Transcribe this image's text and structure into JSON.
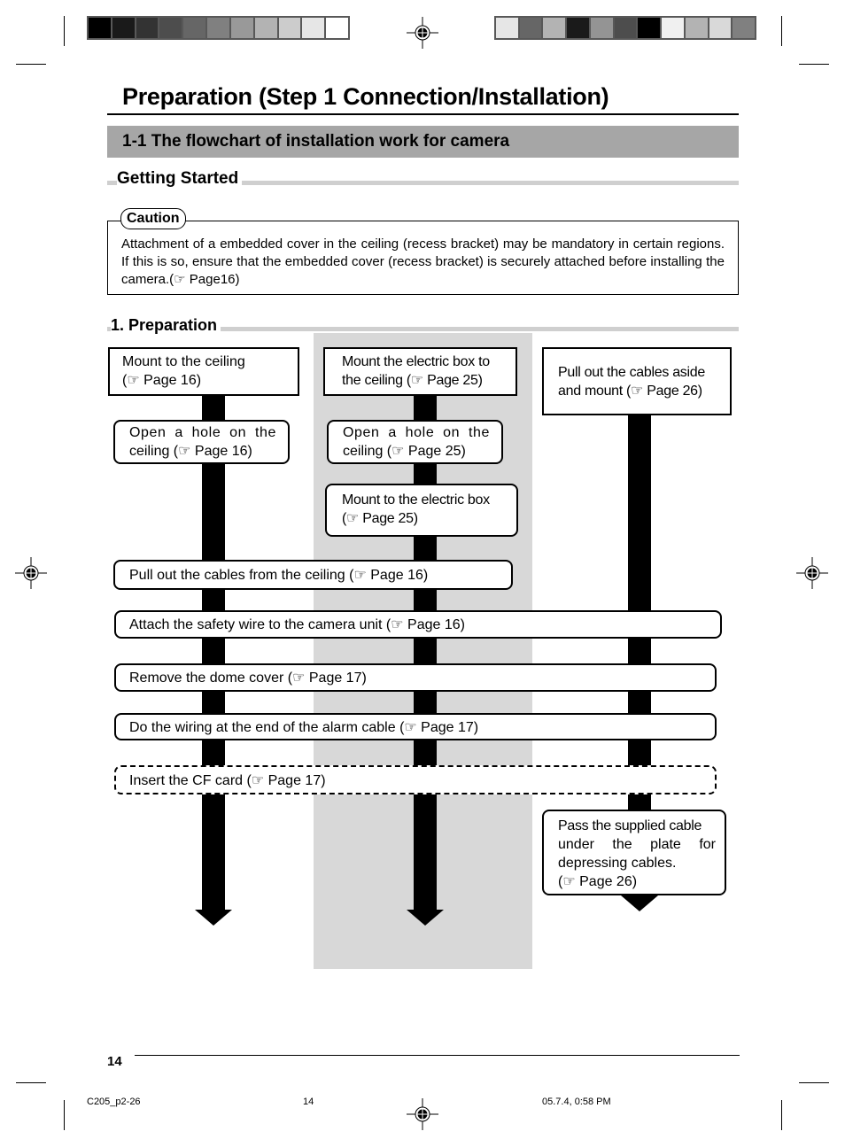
{
  "color_bars": {
    "left": [
      "#000000",
      "#1a1a1a",
      "#333333",
      "#4d4d4d",
      "#666666",
      "#808080",
      "#999999",
      "#b3b3b3",
      "#cccccc",
      "#e6e6e6",
      "#ffffff"
    ],
    "right": [
      "#e6e6e6",
      "#666666",
      "#b3b3b3",
      "#1a1a1a",
      "#949494",
      "#4d4d4d",
      "#000000",
      "#f0f0f0",
      "#b3b3b3",
      "#d9d9d9",
      "#808080"
    ]
  },
  "page": {
    "title": "Preparation (Step 1 Connection/Installation)",
    "section_heading": "1-1 The flowchart of installation work for camera",
    "getting_started_heading": "Getting Started",
    "caution": {
      "label": "Caution",
      "text": "Attachment of a embedded cover in the ceiling (recess bracket) may be mandatory in certain regions. If this is so, ensure that the embedded cover (recess bracket) is securely attached before installing the camera.(☞ Page16)"
    },
    "preparation_heading": "1. Preparation"
  },
  "flowchart": {
    "pointer_glyph": "☞",
    "col1": {
      "step1_line1": "Mount to the ceiling",
      "step1_line2": "(☞ Page 16)",
      "step2_line1": "Open a hole on the",
      "step2_line2": "ceiling (☞ Page 16)"
    },
    "col2": {
      "step1_line1": "Mount the electric box to",
      "step1_line2": "the ceiling (☞ Page 25)",
      "step2_line1": "Open a hole on the",
      "step2_line2": "ceiling (☞ Page 25)",
      "step3_line1": "Mount to the electric box",
      "step3_line2": "(☞ Page 25)"
    },
    "col3": {
      "step1_line1": "Pull out the cables aside",
      "step1_line2": "and mount (☞ Page 26)",
      "last_line1": "Pass the supplied cable",
      "last_line2": "under the plate for",
      "last_line3": "depressing cables.",
      "last_line4": "(☞ Page 26)"
    },
    "shared": {
      "pull_cables": "Pull out the cables from the ceiling (☞ Page 16)",
      "safety_wire": "Attach the safety wire to the camera unit (☞ Page 16)",
      "dome_cover": "Remove the dome cover (☞ Page 17)",
      "alarm_wiring": "Do the wiring at the end of the alarm cable (☞ Page 17)",
      "cf_card": "Insert the CF card (☞ Page 17)"
    }
  },
  "footer": {
    "page_number": "14",
    "slug_file": "C205_p2-26",
    "slug_page": "14",
    "slug_date": "05.7.4, 0:58 PM"
  }
}
